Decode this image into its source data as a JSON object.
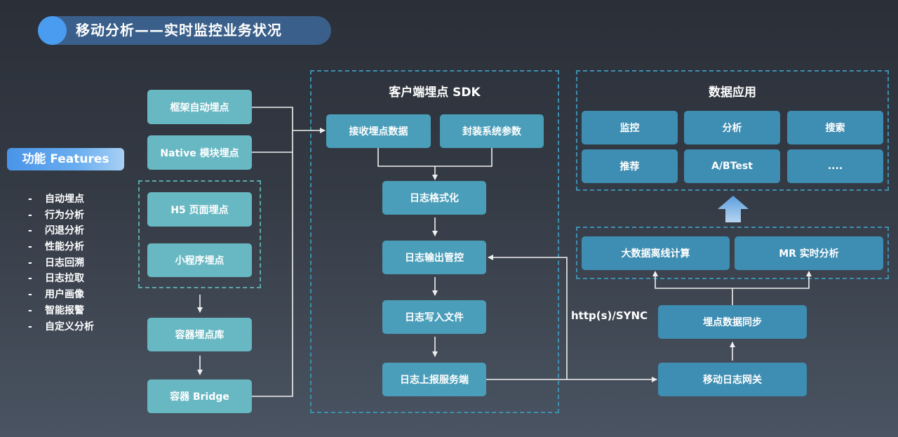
{
  "header": {
    "title": "移动分析——实时监控业务状况",
    "dot_color": "#4a9cf0",
    "pill_color": "#3a5f8a"
  },
  "features": {
    "badge": "功能 Features",
    "bullet": "-",
    "items": [
      "自动埋点",
      "行为分析",
      "闪退分析",
      "性能分析",
      "日志回溯",
      "日志拉取",
      "用户画像",
      "智能报警",
      "自定义分析"
    ]
  },
  "sources": {
    "framework_auto": "框架自动埋点",
    "native_module": "Native 模块埋点",
    "h5_page": "H5 页面埋点",
    "mini_program": "小程序埋点",
    "container_lib": "容器埋点库",
    "container_bridge": "容器 Bridge"
  },
  "sdk": {
    "title": "客户端埋点 SDK",
    "receive": "接收埋点数据",
    "wrap_params": "封装系统参数",
    "format": "日志格式化",
    "output_control": "日志输出管控",
    "write_file": "日志写入文件",
    "upload": "日志上报服务端"
  },
  "connection_label": "http(s)/SYNC",
  "backend": {
    "gateway": "移动日志网关",
    "sync": "埋点数据同步",
    "offline": "大数据离线计算",
    "realtime": "MR 实时分析"
  },
  "applications": {
    "title": "数据应用",
    "items": [
      "监控",
      "分析",
      "搜索",
      "推荐",
      "A/BTest",
      "...."
    ]
  },
  "colors": {
    "source_box": "#68b8c3",
    "sdk_box": "#4a9eba",
    "backend_box": "#3e8db2",
    "dashed_border": "#3d8fb0",
    "connector": "#f0f0f0"
  }
}
